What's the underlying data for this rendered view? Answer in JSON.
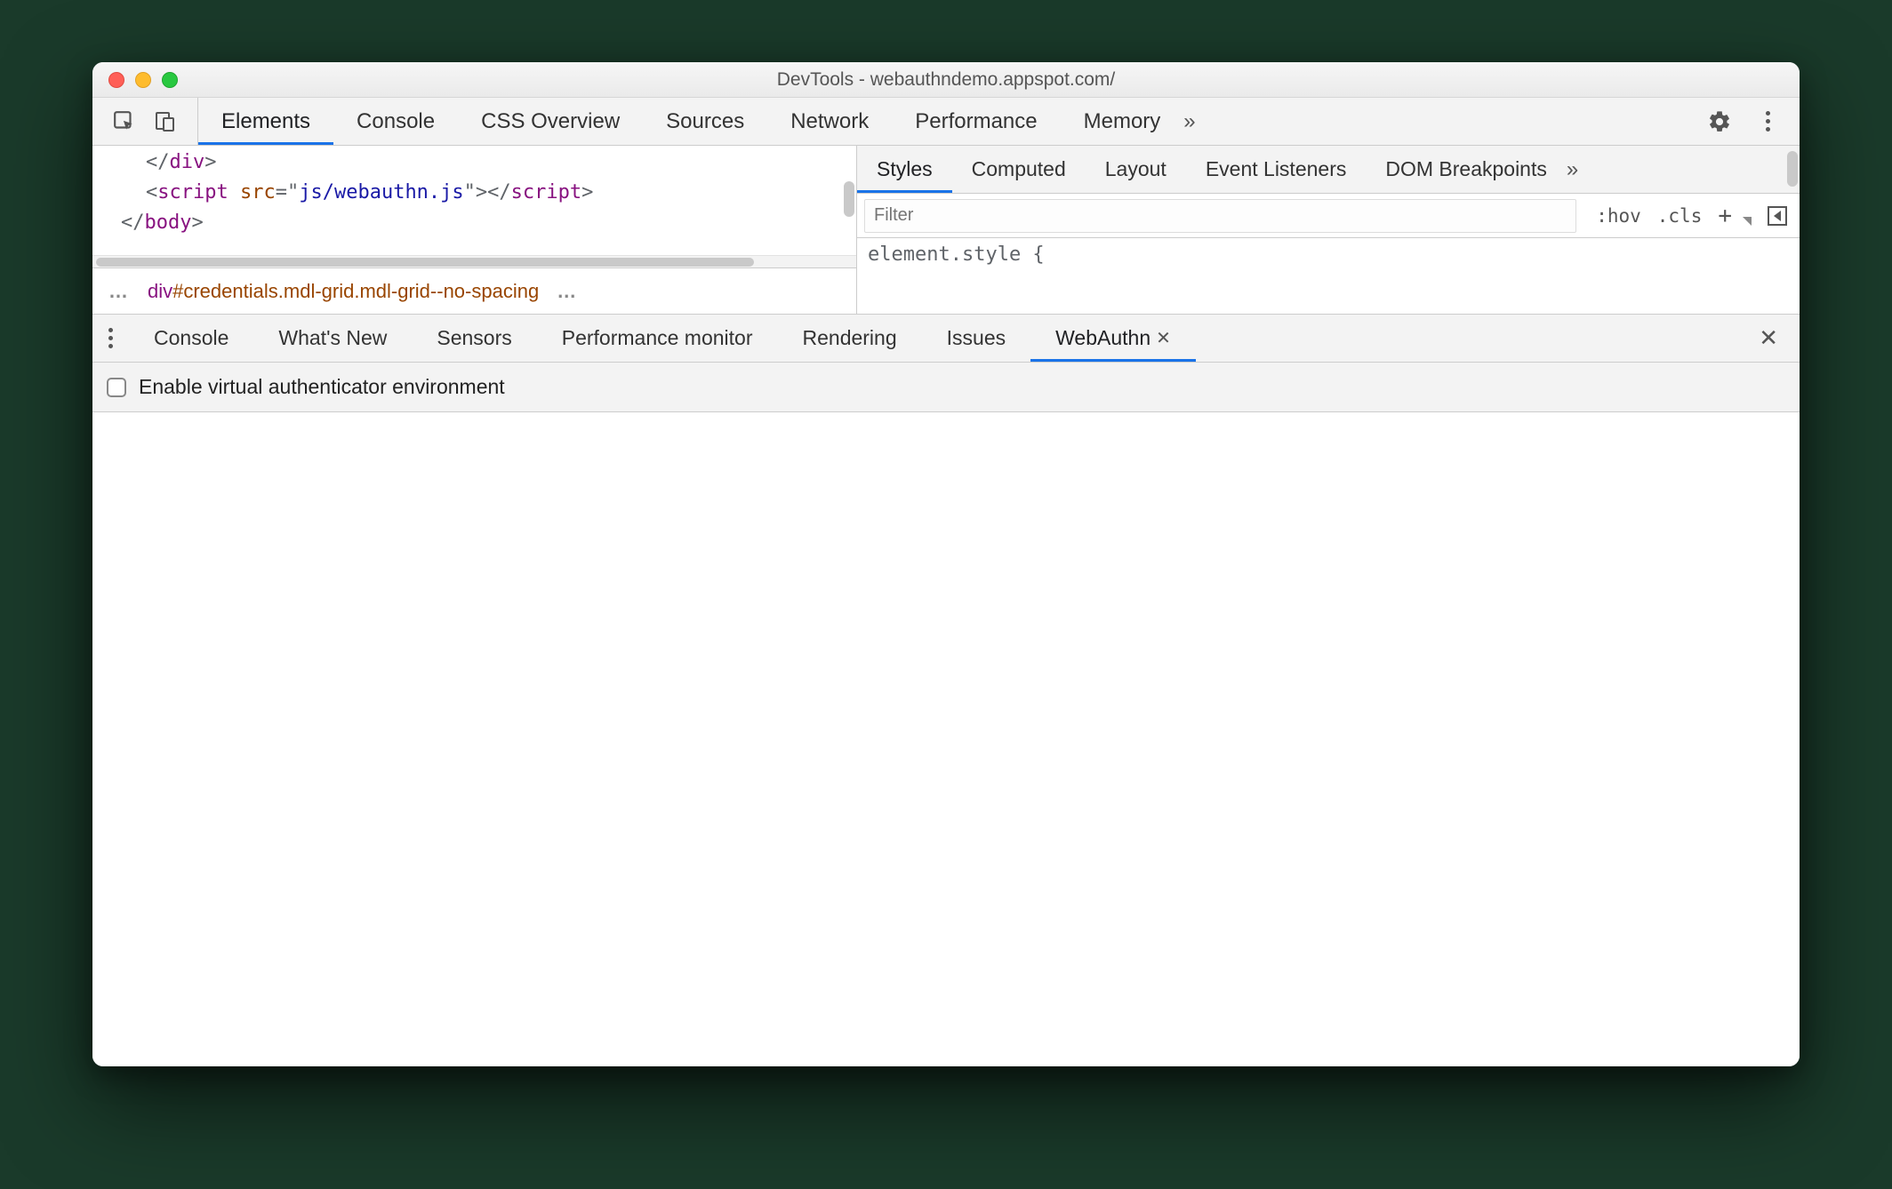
{
  "window": {
    "title": "DevTools - webauthndemo.appspot.com/"
  },
  "mainTabs": {
    "items": [
      "Elements",
      "Console",
      "CSS Overview",
      "Sources",
      "Network",
      "Performance",
      "Memory"
    ],
    "active": "Elements",
    "overflow": "»"
  },
  "code": {
    "l1_close_div": "</div>",
    "l2_open": "<script ",
    "l2_attr": "src",
    "l2_eq": "=\"",
    "l2_val": "js/webauthn.js",
    "l2_end": "\"></scr",
    "l2_end2": "ipt>",
    "l3_close_body": "</body>"
  },
  "breadcrumb": {
    "ellipsis": "…",
    "tag": "div",
    "id": "#credentials",
    "cls": ".mdl-grid.mdl-grid--no-spacing",
    "ellipsis2": "…"
  },
  "stylesTabs": {
    "items": [
      "Styles",
      "Computed",
      "Layout",
      "Event Listeners",
      "DOM Breakpoints"
    ],
    "active": "Styles",
    "overflow": "»"
  },
  "filter": {
    "placeholder": "Filter",
    "hov": ":hov",
    "cls": ".cls"
  },
  "stylesBody": {
    "text": "element.style {"
  },
  "drawer": {
    "items": [
      "Console",
      "What's New",
      "Sensors",
      "Performance monitor",
      "Rendering",
      "Issues",
      "WebAuthn"
    ],
    "active": "WebAuthn"
  },
  "webauthn": {
    "checkbox_label": "Enable virtual authenticator environment"
  }
}
